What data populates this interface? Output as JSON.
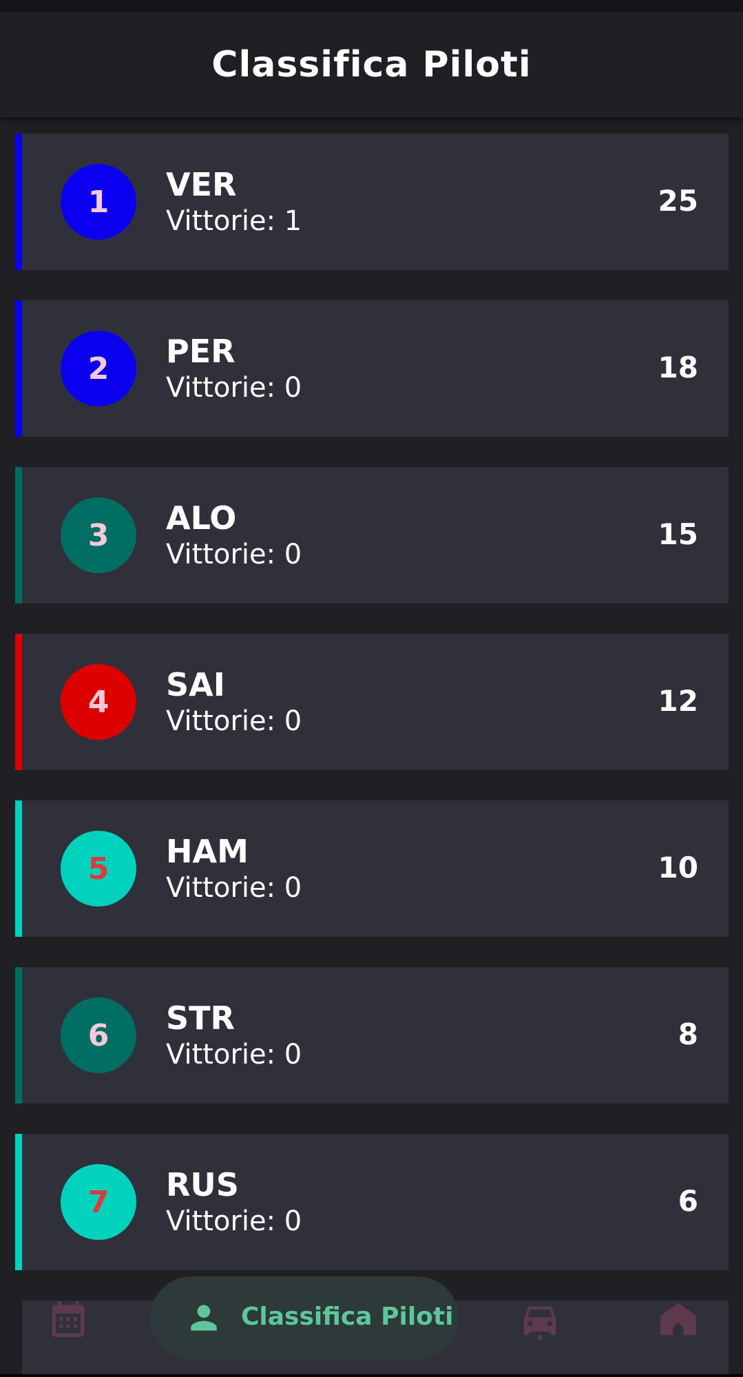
{
  "app_bar": {
    "title": "Classifica Piloti"
  },
  "standings": [
    {
      "position": "1",
      "code": "VER",
      "wins": "Vittorie: 1",
      "points": "25",
      "team_color": "#0a00ef",
      "number_color": "#f6c9d8"
    },
    {
      "position": "2",
      "code": "PER",
      "wins": "Vittorie: 0",
      "points": "18",
      "team_color": "#0a00ef",
      "number_color": "#f6c9d8"
    },
    {
      "position": "3",
      "code": "ALO",
      "wins": "Vittorie: 0",
      "points": "15",
      "team_color": "#006e62",
      "number_color": "#f6c9d8"
    },
    {
      "position": "4",
      "code": "SAI",
      "wins": "Vittorie: 0",
      "points": "12",
      "team_color": "#dc0000",
      "number_color": "#f6c9d8"
    },
    {
      "position": "5",
      "code": "HAM",
      "wins": "Vittorie: 0",
      "points": "10",
      "team_color": "#00d2be",
      "number_color": "#dc3a3a"
    },
    {
      "position": "6",
      "code": "STR",
      "wins": "Vittorie: 0",
      "points": "8",
      "team_color": "#006e62",
      "number_color": "#f6c9d8"
    },
    {
      "position": "7",
      "code": "RUS",
      "wins": "Vittorie: 0",
      "points": "6",
      "team_color": "#00d2be",
      "number_color": "#dc3a3a"
    }
  ],
  "bottom_nav": {
    "items": [
      {
        "icon": "calendar-icon",
        "label": "",
        "selected": false
      },
      {
        "icon": "person-icon",
        "label": "Classifica Piloti",
        "selected": true
      },
      {
        "icon": "car-icon",
        "label": "",
        "selected": false
      },
      {
        "icon": "garage-icon",
        "label": "",
        "selected": false
      }
    ],
    "active_color": "#5ec79a",
    "inactive_color": "#5e3a4c"
  }
}
